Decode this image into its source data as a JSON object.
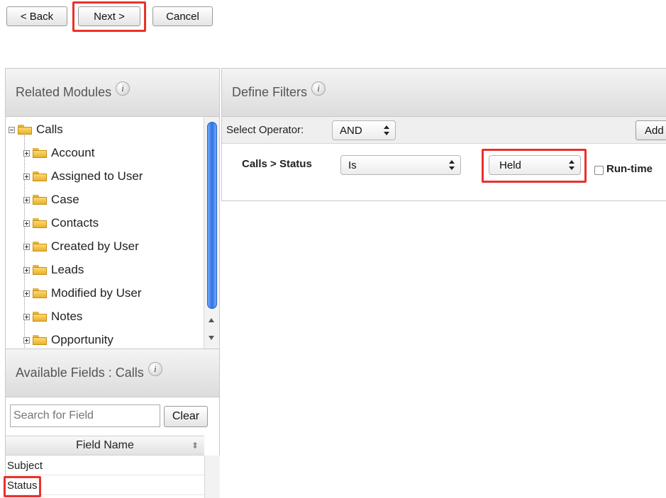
{
  "toolbar": {
    "back_label": "< Back",
    "next_label": "Next >",
    "cancel_label": "Cancel"
  },
  "related_modules": {
    "title": "Related Modules",
    "info_glyph": "i",
    "root": "Calls",
    "items": [
      {
        "label": "Account"
      },
      {
        "label": "Assigned to User"
      },
      {
        "label": "Case"
      },
      {
        "label": "Contacts"
      },
      {
        "label": "Created by User"
      },
      {
        "label": "Leads"
      },
      {
        "label": "Modified by User"
      },
      {
        "label": "Notes"
      },
      {
        "label": "Opportunity"
      }
    ]
  },
  "available_fields": {
    "title": "Available Fields : Calls",
    "info_glyph": "i",
    "search_placeholder": "Search for Field",
    "clear_label": "Clear",
    "column_header": "Field Name",
    "fields": [
      "Subject",
      "Status"
    ]
  },
  "define_filters": {
    "title": "Define Filters",
    "info_glyph": "i",
    "operator_label": "Select Operator:",
    "operator_value": "AND",
    "add_label": "Add",
    "filter": {
      "field_label": "Calls > Status",
      "condition_value": "Is",
      "value_selected": "Held",
      "runtime_label": "Run-time"
    }
  },
  "colors": {
    "highlight": "#e8322a",
    "scroll_thumb": "#2f74e0",
    "folder": "#ffd86a"
  }
}
